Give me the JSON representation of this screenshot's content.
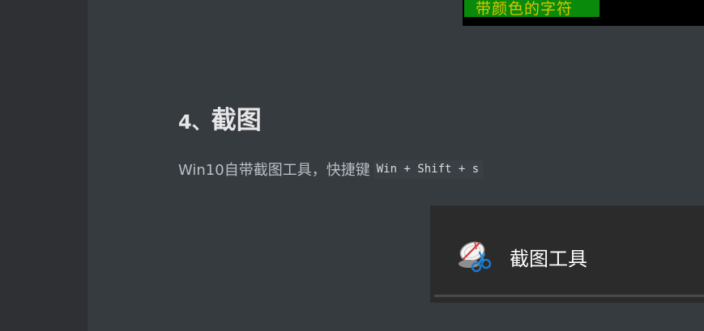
{
  "top_image": {
    "text": "带颜色的字符"
  },
  "section": {
    "number": "4、",
    "title": "截图"
  },
  "paragraph": {
    "text": "Win10自带截图工具，快捷键",
    "shortcut": "Win + Shift + s"
  },
  "search_result": {
    "app_label": "截图工具",
    "icon": "snipping-tool-icon"
  },
  "colors": {
    "editor_background": "#363b40",
    "sidebar_background": "#2e3033",
    "panel_background": "#2b2b2b",
    "term_green": "#0a8a0a",
    "term_text": "#d8c400"
  }
}
